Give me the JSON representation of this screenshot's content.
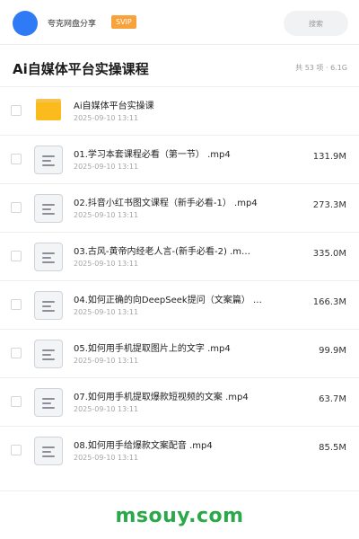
{
  "header": {
    "user_name": "夸克网盘分享",
    "vip_badge": "SVIP",
    "search_placeholder": "搜索"
  },
  "title_bar": {
    "title": "Ai自媒体平台实操课程",
    "summary": "共 53 项 · 6.1G"
  },
  "files": [
    {
      "name": "Ai自媒体平台实操课",
      "date": "2025-09-10 13:11",
      "size": "",
      "icon": "folder-icon"
    },
    {
      "name": "01.学习本套课程必看（第一节） .mp4",
      "date": "2025-09-10 13:11",
      "size": "131.9M",
      "icon": "video-file-icon"
    },
    {
      "name": "02.抖音小红书图文课程（新手必看-1） .mp4",
      "date": "2025-09-10 13:11",
      "size": "273.3M",
      "icon": "video-file-icon"
    },
    {
      "name": "03.古风-黄帝内经老人言-(新手必看-2) .m…",
      "date": "2025-09-10 13:11",
      "size": "335.0M",
      "icon": "video-file-icon"
    },
    {
      "name": "04.如何正确的向DeepSeek提问（文案篇） …",
      "date": "2025-09-10 13:11",
      "size": "166.3M",
      "icon": "video-file-icon"
    },
    {
      "name": "05.如何用手机提取图片上的文字 .mp4",
      "date": "2025-09-10 13:11",
      "size": "99.9M",
      "icon": "video-file-icon"
    },
    {
      "name": "07.如何用手机提取爆款短视频的文案 .mp4",
      "date": "2025-09-10 13:11",
      "size": "63.7M",
      "icon": "video-file-icon"
    },
    {
      "name": "08.如何用手给爆款文案配音 .mp4",
      "date": "2025-09-10 13:11",
      "size": "85.5M",
      "icon": "video-file-icon"
    }
  ],
  "watermark": "msouy.com"
}
